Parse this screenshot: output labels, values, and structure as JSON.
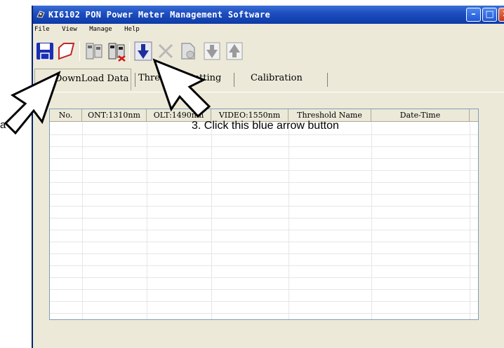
{
  "window": {
    "title": "KI6102 PON Power Meter Management Software",
    "title_buttons": {
      "minimize": "–",
      "maximize": "□",
      "close": "✕"
    }
  },
  "menu": [
    "File",
    "View",
    "Manage",
    "Help"
  ],
  "toolbar": [
    {
      "icon": "save-icon"
    },
    {
      "icon": "open-folder-icon"
    },
    {
      "icon": "device-connect-icon"
    },
    {
      "icon": "device-disconnect-icon"
    },
    {
      "icon": "download-blue-arrow-icon"
    },
    {
      "icon": "delete-x-icon"
    },
    {
      "icon": "clear-icon"
    },
    {
      "icon": "move-down-icon"
    },
    {
      "icon": "move-up-icon"
    }
  ],
  "tabs": [
    {
      "label": "DownLoad Data",
      "active": true
    },
    {
      "label": "Threshold Setting",
      "active": false
    },
    {
      "label": "Calibration",
      "active": false
    }
  ],
  "table": {
    "columns": [
      "No.",
      "ONT:1310nm",
      "OLT:1490nm",
      "VIDEO:1550nm",
      "Threshold Name",
      "Date-Time"
    ],
    "rows": []
  },
  "annotations": {
    "step3": "3. Click this blue arrow button",
    "left_fragment": "a"
  },
  "colors": {
    "titlebar": "#0c3aa8",
    "download_arrow": "#1c2f9c",
    "save_icon": "#1a2fb4"
  }
}
